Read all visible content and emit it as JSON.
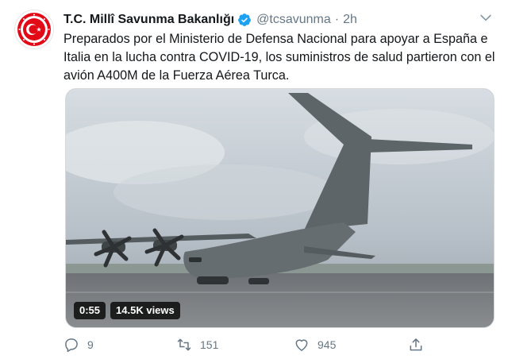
{
  "tweet": {
    "display_name": "T.C. Millî Savunma Bakanlığı",
    "handle": "@tcsavunma",
    "separator": "·",
    "time": "2h",
    "text": "Preparados por el Ministerio de Defensa Nacional para apoyar a España e Italia en la lucha contra COVID-19, los suministros de salud partieron con el avión A400M de la Fuerza Aérea Turca.",
    "media": {
      "duration": "0:55",
      "views": "14.5K views"
    },
    "actions": {
      "replies": "9",
      "retweets": "151",
      "likes": "945"
    }
  },
  "colors": {
    "text": "#14171a",
    "secondary": "#657786",
    "verified": "#1da1f2",
    "logo_red": "#e30a17"
  },
  "icons": [
    "ministry-logo-icon",
    "verified-badge-icon",
    "chevron-down-icon",
    "reply-icon",
    "retweet-icon",
    "like-icon",
    "share-icon"
  ]
}
